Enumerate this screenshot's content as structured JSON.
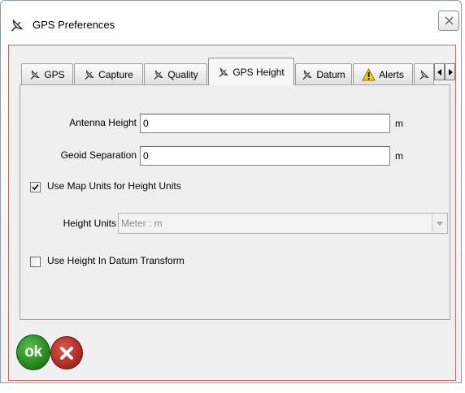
{
  "window": {
    "title": "GPS Preferences",
    "title_icon": "gps-icon",
    "close_icon": "close-icon"
  },
  "tabs": [
    {
      "label": "GPS",
      "icon": "gps-icon",
      "selected": false
    },
    {
      "label": "Capture",
      "icon": "gps-icon",
      "selected": false
    },
    {
      "label": "Quality",
      "icon": "gps-icon",
      "selected": false
    },
    {
      "label": "GPS Height",
      "icon": "gps-icon",
      "selected": true
    },
    {
      "label": "Datum",
      "icon": "gps-icon",
      "selected": false
    },
    {
      "label": "Alerts",
      "icon": "warning-icon",
      "selected": false
    }
  ],
  "tab_scroll": {
    "left_icon": "arrow-left-icon",
    "right_icon": "arrow-right-icon"
  },
  "gps_height": {
    "antenna_height": {
      "label": "Antenna Height",
      "value": "0",
      "unit": "m"
    },
    "geoid_separation": {
      "label": "Geoid Separation",
      "value": "0",
      "unit": "m"
    },
    "use_map_units": {
      "label": "Use Map Units for Height Units",
      "checked": true
    },
    "height_units": {
      "label": "Height Units",
      "value": "Meter : m",
      "disabled": true
    },
    "use_height_datum": {
      "label": "Use Height In Datum Transform",
      "checked": false
    }
  },
  "buttons": {
    "ok_label": "ok",
    "cancel_icon": "cancel-icon"
  },
  "colors": {
    "ok_green": "#2a8d24",
    "cancel_red": "#b3302b",
    "warning_yellow": "#f6d100",
    "dialog_gray": "#f0f0f0"
  }
}
